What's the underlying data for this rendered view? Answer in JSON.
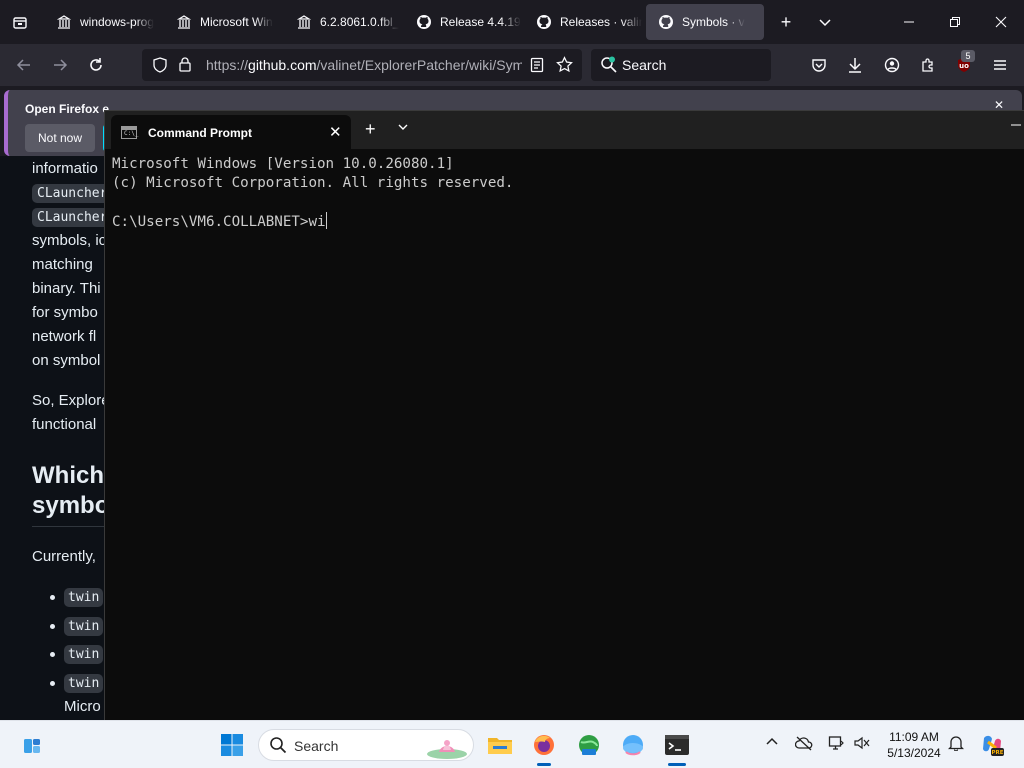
{
  "browser": {
    "tabs": [
      {
        "label": "windows-prog",
        "icon": "library-icon",
        "active": false
      },
      {
        "label": "Microsoft Win",
        "icon": "library-icon",
        "active": false
      },
      {
        "label": "6.2.8061.0.fbl_",
        "icon": "library-icon",
        "active": false
      },
      {
        "label": "Release 4.4.19",
        "icon": "github-icon",
        "active": false
      },
      {
        "label": "Releases · valin",
        "icon": "github-icon",
        "active": false
      },
      {
        "label": "Symbols · v",
        "icon": "github-icon",
        "active": true
      }
    ],
    "url_prefix": "https://",
    "url_main": "github.com",
    "url_rest": "/valinet/ExplorerPatcher/wiki/Sym",
    "search_placeholder": "Search",
    "extension_badge": "5"
  },
  "notification": {
    "title": "Open Firefox e",
    "not_now_label": "Not now"
  },
  "wiki": {
    "lines": [
      {
        "text": "informatio",
        "kind": "text"
      },
      {
        "text": "CLauncher",
        "kind": "code"
      },
      {
        "text": "CLauncher",
        "kind": "code"
      },
      {
        "text": "symbols, ic",
        "kind": "text"
      },
      {
        "text": "matching ",
        "kind": "text"
      },
      {
        "text": "binary. Thi",
        "kind": "text"
      },
      {
        "text": "for symbo",
        "kind": "text"
      },
      {
        "text": "network fl",
        "kind": "text"
      },
      {
        "text": "on symbol",
        "kind": "text"
      },
      {
        "text": "So, Explore",
        "kind": "text"
      },
      {
        "text": "functional",
        "kind": "text"
      }
    ],
    "heading_line1": "Which",
    "heading_line2": "symbo",
    "currently": "Currently,",
    "list_items": [
      "twin",
      "twin",
      "twin",
      "twin"
    ],
    "last_line": "Micro"
  },
  "cmd": {
    "tab_title": "Command Prompt",
    "icon_text": "C:\\_",
    "line1": "Microsoft Windows [Version 10.0.26080.1]",
    "line2": "(c) Microsoft Corporation. All rights reserved.",
    "prompt": "C:\\Users\\VM6.COLLABNET>wi"
  },
  "taskbar": {
    "search_label": "Search",
    "time": "11:09 AM",
    "date": "5/13/2024"
  },
  "colors": {
    "accent": "#005fb8",
    "notif_primary": "#00ddff",
    "firefox_bg": "#1c1b22"
  }
}
